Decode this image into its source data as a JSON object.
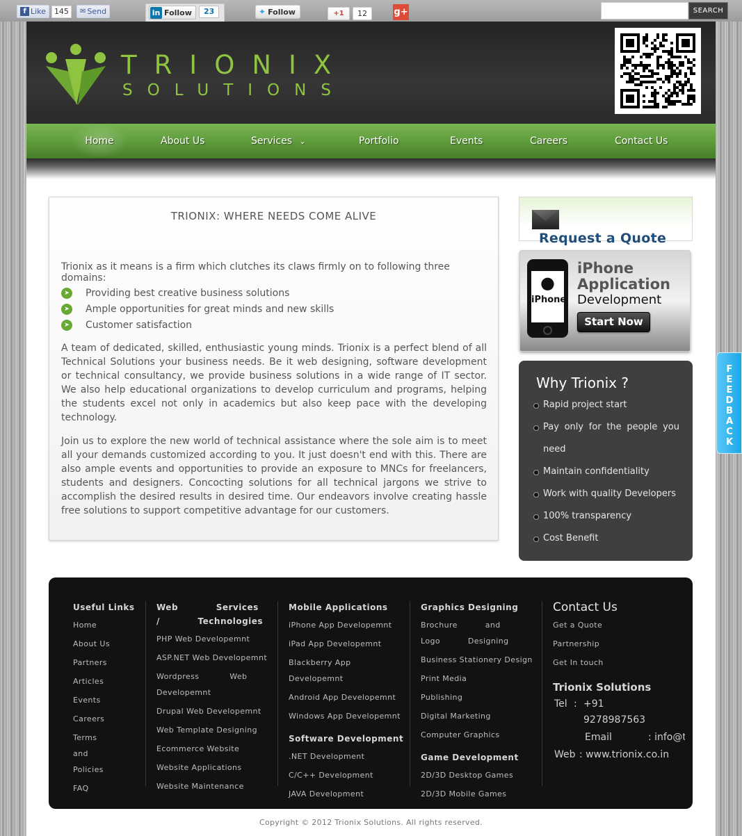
{
  "social": {
    "fb_like": "Like",
    "fb_like_count": "145",
    "fb_send": "Send",
    "linkedin_follow": "Follow",
    "linkedin_count": "23",
    "twitter_follow": "Follow",
    "gplus_label": "+1",
    "gplus_count": "12",
    "gplus_icon": "g+"
  },
  "search": {
    "placeholder": "",
    "button": "SEARCH"
  },
  "brand": {
    "line1": "TRIONIX",
    "line2": "SOLUTIONS"
  },
  "nav": {
    "items": [
      {
        "label": "Home"
      },
      {
        "label": "About Us"
      },
      {
        "label": "Services"
      },
      {
        "label": "Portfolio"
      },
      {
        "label": "Events"
      },
      {
        "label": "Careers"
      },
      {
        "label": "Contact Us"
      }
    ],
    "active": "Home"
  },
  "main": {
    "title": "TRIONIX: WHERE NEEDS COME ALIVE",
    "intro": "Trionix as it means is a firm which clutches its claws firmly on to following three domains:",
    "bullets": [
      "Providing best creative business solutions",
      "Ample opportunities for great minds and new skills",
      "Customer satisfaction"
    ],
    "para1": "A team of dedicated, skilled, enthusiastic young minds. Trionix is a perfect blend of all Technical Solutions your business needs. Be it web designing, software development or technical consultancy, we provide business solutions in a wide range of IT sector. We also help educational organizations to develop curriculum and programs, helping the students excel not only in academics but also keep pace with the developing technology.",
    "para2": "Join us to explore the new world of technical assistance where the sole aim is to meet all your demands customized according to you. It just doesn't end with this. There are also ample  events and opportunities to provide an exposure to MNCs for freelancers, students  and  designers. Concocting solutions for all technical jargons we strive to accomplish the desired results in desired time. Our endeavors involve creating hassle free solutions to support competitive advantage for our customers."
  },
  "sidebar": {
    "quote_label": "Request a Quote",
    "iphone": {
      "screen_label": "iPhone",
      "line1": "iPhone",
      "line2": "Application",
      "line3": "Development",
      "button": "Start Now"
    },
    "why": {
      "title": "Why Trionix ?",
      "items": [
        "Rapid project start",
        "Pay only for the people you need",
        "Maintain confidentiality",
        "Work with quality Developers",
        "100% transparency",
        "Cost Benefit"
      ]
    }
  },
  "footer": {
    "useful": {
      "title": "Useful Links",
      "links": [
        "Home",
        "About Us",
        "Partners",
        "Articles",
        "Events",
        "Careers",
        "Terms and Policies",
        "FAQ"
      ]
    },
    "web": {
      "title": "Web Services / Technologies",
      "links": [
        "PHP Web Developemnt",
        "ASP.NET Web Developemnt",
        "Wordpress Web Developemnt",
        "Drupal Web Developemnt",
        "Web Template Designing",
        "Ecommerce Website",
        "Website Applications",
        "Website Maintenance"
      ]
    },
    "mobile": {
      "title": "Mobile Applications",
      "links": [
        "iPhone App Developemnt",
        "iPad App Developemnt",
        "Blackberry App Developemnt",
        "Android App Developemnt",
        "Windows App Developemnt"
      ],
      "software_title": "Software Development",
      "software_links": [
        ".NET Development",
        "C/C++ Development",
        "JAVA Development"
      ]
    },
    "graphics": {
      "title": "Graphics Designing",
      "links": [
        "Brochure and Logo Designing",
        "Business Stationery Design",
        "Print Media",
        "Publishing",
        "Digital Marketing",
        "Computer Graphics"
      ],
      "game_title": "Game Development",
      "game_links": [
        "2D/3D Desktop Games",
        "2D/3D Mobile Games"
      ]
    },
    "contact": {
      "title": "Contact Us",
      "links": [
        "Get a Quote",
        "Partnership",
        "Get In touch"
      ],
      "company": "Trionix Solutions",
      "tel_label": "Tel",
      "tel_sep": ":",
      "tel_value": "+91 9278987563",
      "email_label": "Email",
      "email_value": ": info@trionix",
      "web_label": "Web",
      "web_value": ": www.trionix.co.in"
    },
    "copyright": "Copyright © 2012 Trionix Solutions. All rights reserved."
  },
  "feedback": "FEEDBACK",
  "colors": {
    "brand_green": "#8fc441",
    "nav_green": "#5d9a3a",
    "quote_blue": "#1f4e7a",
    "feedback_blue": "#1aa7e8"
  }
}
